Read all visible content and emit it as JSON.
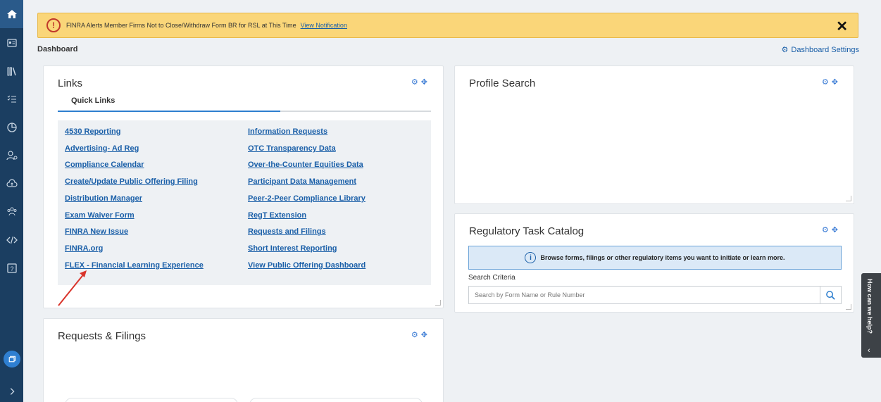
{
  "alert": {
    "text": "FINRA Alerts Member Firms Not to Close/Withdraw Form BR for RSL at This Time",
    "link": "View Notification",
    "close": "✕"
  },
  "header": {
    "title": "Dashboard",
    "settings": "Dashboard Settings"
  },
  "links_panel": {
    "title": "Links",
    "tab": "Quick Links",
    "left_links": [
      "4530 Reporting",
      "Advertising- Ad Reg",
      "Compliance Calendar",
      "Create/Update Public Offering Filing",
      "Distribution Manager",
      "Exam Waiver Form",
      "FINRA New Issue",
      "FINRA.org",
      "FLEX - Financial Learning Experience"
    ],
    "right_links": [
      "Information Requests",
      "OTC Transparency Data",
      "Over-the-Counter Equities Data",
      "Participant Data Management",
      "Peer-2-Peer Compliance Library",
      "RegT Extension",
      "Requests and Filings",
      "Short Interest Reporting",
      "View Public Offering Dashboard"
    ]
  },
  "profile_panel": {
    "title": "Profile Search"
  },
  "regulatory_panel": {
    "title": "Regulatory Task Catalog",
    "info": "Browse forms, filings or other regulatory items you want to initiate or learn more.",
    "search_label": "Search Criteria",
    "search_placeholder": "Search by Form Name or Rule Number"
  },
  "requests_panel": {
    "title": "Requests & Filings"
  },
  "help": {
    "label": "How can we help?"
  },
  "colors": {
    "sidebar": "#1b3e61",
    "link": "#1a5fa8",
    "alert_bg": "#fad679",
    "accent": "#2e7fcf"
  },
  "icons": [
    "home-icon",
    "id-card-icon",
    "library-icon",
    "checklist-icon",
    "chart-icon",
    "user-settings-icon",
    "cloud-upload-icon",
    "group-icon",
    "code-icon",
    "help-box-icon",
    "gear-icon",
    "move-icon",
    "search-icon",
    "info-icon",
    "alert-icon"
  ]
}
